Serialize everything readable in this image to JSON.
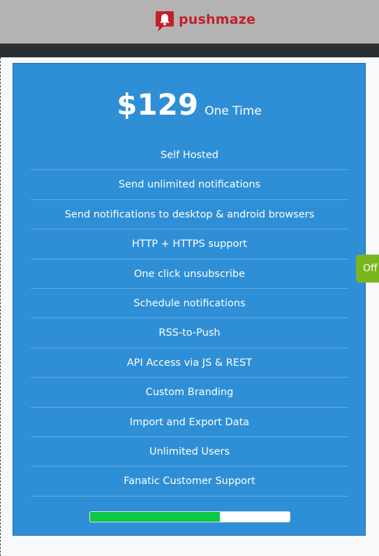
{
  "header": {
    "logo_text": "pushmaze",
    "logo_icon": "bell-speech-icon",
    "brand_color": "#c4202a"
  },
  "pricing": {
    "price": "$129",
    "period": "One Time",
    "card_color": "#2f8fd6",
    "features": [
      "Self Hosted",
      "Send unlimited notifications",
      "Send notifications to desktop & android browsers",
      "HTTP + HTTPS support",
      "One click unsubscribe",
      "Schedule notifications",
      "RSS-to-Push",
      "API Access via JS & REST",
      "Custom Branding",
      "Import and Export Data",
      "Unlimited Users",
      "Fanatic Customer Support"
    ],
    "progress_fraction": 0.65,
    "progress_color": "#0ec745"
  },
  "side_tab": {
    "label": "Off",
    "color": "#79b51c"
  }
}
